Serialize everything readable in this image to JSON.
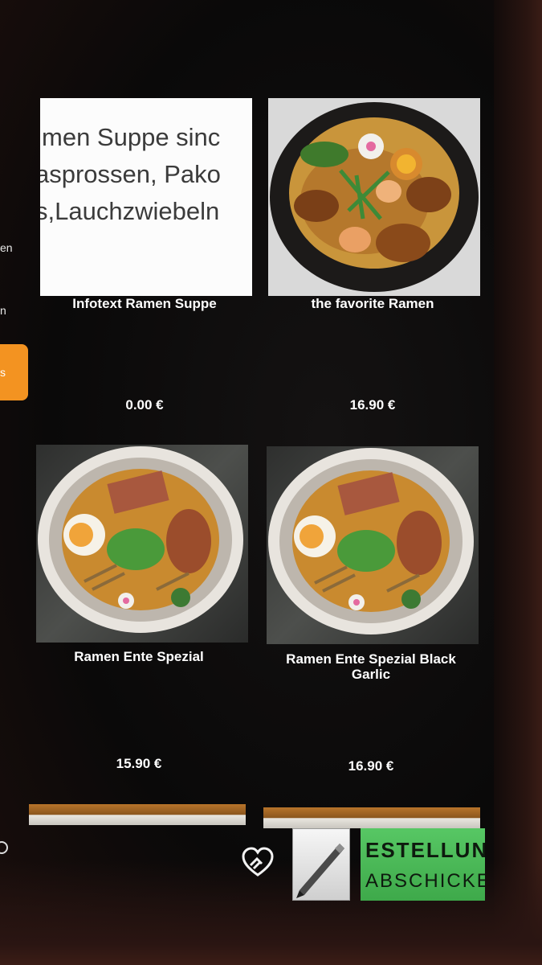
{
  "sidebar": {
    "items": [
      {
        "label": "en"
      },
      {
        "label": "n"
      },
      {
        "label": "s"
      }
    ]
  },
  "products": [
    {
      "name": "Infotext Ramen Suppe",
      "price": "0.00 €",
      "thumb_text": [
        "men Suppe sinc",
        "asprossen, Pako",
        "s,Lauchzwiebeln"
      ]
    },
    {
      "name": "the favorite Ramen",
      "price": "16.90 €",
      "image": "ramen-bowl-fried-chicken-shrimp"
    },
    {
      "name": "Ramen Ente Spezial",
      "price": "15.90 €",
      "image": "ramen-bowl-duck"
    },
    {
      "name": "Ramen Ente Spezial Black Garlic",
      "price": "16.90 €",
      "image": "ramen-bowl-duck"
    }
  ],
  "footer": {
    "order_line1": "ESTELLUNG",
    "order_line2": "ABSCHICKEN",
    "favorite_icon": "heart-hand-icon",
    "edit_icon": "pen-icon"
  },
  "colors": {
    "accent": "#f39321",
    "order_green": "#4cbb58",
    "background": "#0b0a0a"
  }
}
